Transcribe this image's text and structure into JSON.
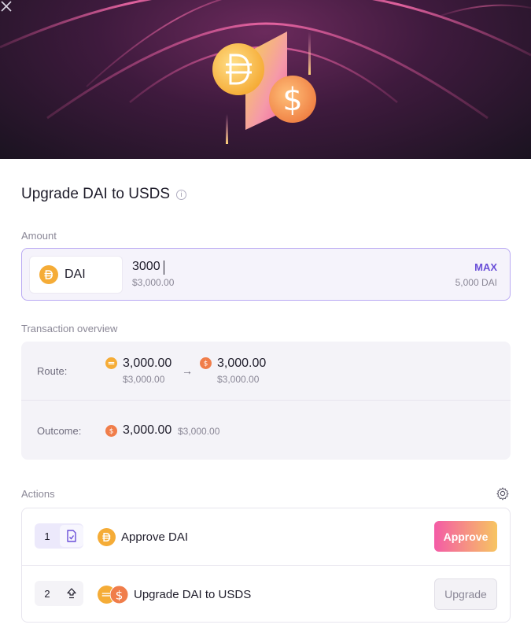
{
  "header": {
    "close_label": "×"
  },
  "title": {
    "text": "Upgrade DAI to USDS",
    "info_icon": "info-icon"
  },
  "amount": {
    "label": "Amount",
    "token_symbol": "DAI",
    "value": "3000",
    "usd_value": "$3,000.00",
    "max_label": "MAX",
    "balance": "5,000 DAI"
  },
  "overview": {
    "label": "Transaction overview",
    "route_label": "Route:",
    "route_from_amount": "3,000.00",
    "route_from_usd": "$3,000.00",
    "route_arrow": "→",
    "route_to_amount": "3,000.00",
    "route_to_usd": "$3,000.00",
    "outcome_label": "Outcome:",
    "outcome_amount": "3,000.00",
    "outcome_usd": "$3,000.00"
  },
  "actions": {
    "label": "Actions",
    "steps": [
      {
        "number": "1",
        "label": "Approve DAI",
        "button": "Approve",
        "icon": "approve-doc-icon"
      },
      {
        "number": "2",
        "label": "Upgrade DAI to USDS",
        "button": "Upgrade",
        "icon": "upgrade-arrow-icon"
      }
    ]
  },
  "colors": {
    "accent": "#6a4fd8",
    "dai": "#f5ac37",
    "usds": "#f07d4a",
    "approve_gradient_start": "#f45ba6",
    "approve_gradient_end": "#f7c561"
  }
}
